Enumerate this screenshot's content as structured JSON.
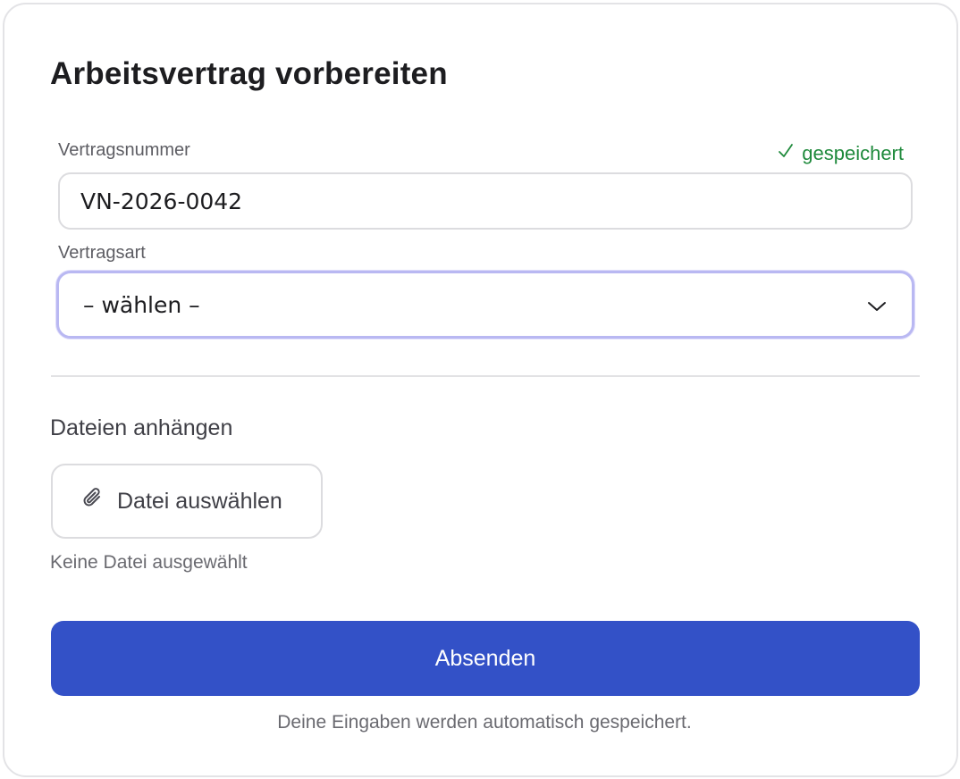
{
  "form": {
    "title": "Arbeitsvertrag vorbereiten",
    "contract_number": {
      "label": "Vertragsnummer",
      "value": "VN-2026-0042",
      "status": "gespeichert",
      "status_icon": "check-icon",
      "status_color": "#1f8a3c"
    },
    "contract_type": {
      "label": "Vertragsart",
      "selected": "– wählen –",
      "icon": "chevron-down-icon"
    },
    "attachments": {
      "heading": "Dateien anhängen",
      "button_label": "Datei auswählen",
      "button_icon": "paperclip-icon",
      "status": "Keine Datei ausgewählt"
    },
    "submit_label": "Absenden",
    "submit_color": "#3351c7",
    "autosave_note": "Deine Eingaben werden automatisch gespeichert."
  }
}
